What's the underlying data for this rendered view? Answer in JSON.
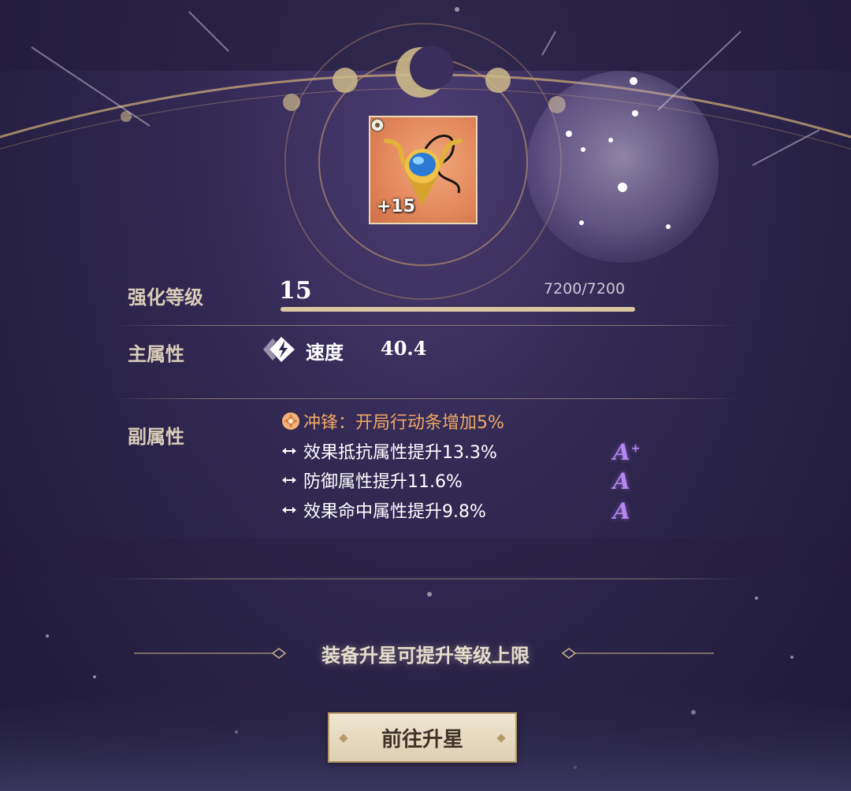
{
  "equipment": {
    "icon": "gold-blue-gem-necklace",
    "card_color": "#e48a5e",
    "level_badge": "+15"
  },
  "enhance": {
    "label": "强化等级",
    "value": "15",
    "exp": "7200/7200",
    "progress": 1.0
  },
  "main_stat": {
    "label": "主属性",
    "icon": "speed-icon",
    "name": "速度",
    "value": "40.4"
  },
  "sub_stats": {
    "label": "副属性",
    "set_effect": {
      "icon": "set-effect-icon",
      "text": "冲锋：开局行动条增加5%",
      "color": "#f0a864"
    },
    "items": [
      {
        "text": "效果抵抗属性提升13.3%",
        "grade": "A",
        "grade_plus": "+"
      },
      {
        "text": "防御属性提升11.6%",
        "grade": "A",
        "grade_plus": ""
      },
      {
        "text": "效果命中属性提升9.8%",
        "grade": "A",
        "grade_plus": ""
      }
    ],
    "grade_color": "#b688f0"
  },
  "hint": "装备升星可提升等级上限",
  "button": {
    "label": "前往升星"
  },
  "colors": {
    "background": "#2e2650",
    "accent_gold": "#d9c8a2"
  }
}
